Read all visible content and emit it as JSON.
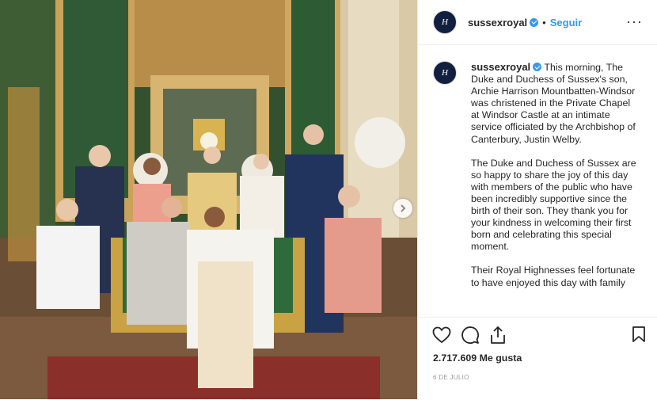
{
  "photo": {
    "description_icon": "family-photo"
  },
  "header": {
    "username": "sussexroyal",
    "avatar_text": "H",
    "follow_label": "Seguir",
    "dot": "•",
    "more_label": "···"
  },
  "caption": {
    "username": "sussexroyal",
    "paragraphs": [
      "This morning, The Duke and Duchess of Sussex's son, Archie Harrison Mountbatten-Windsor was christened in the Private Chapel at Windsor Castle at an intimate service officiated by the Archbishop of Canterbury, Justin Welby.",
      "The Duke and Duchess of Sussex are so happy to share the joy of this day with members of the public who have been incredibly supportive since the birth of their son. They thank you for your kindness in welcoming their first born and celebrating this special moment.",
      "Their Royal Highnesses feel fortunate to have enjoyed this day with family"
    ]
  },
  "actions": {
    "likes": "2.717.609 Me gusta",
    "date": "6 DE JULIO"
  },
  "colors": {
    "accent": "#3897f0",
    "text": "#262626",
    "muted": "#999999"
  }
}
